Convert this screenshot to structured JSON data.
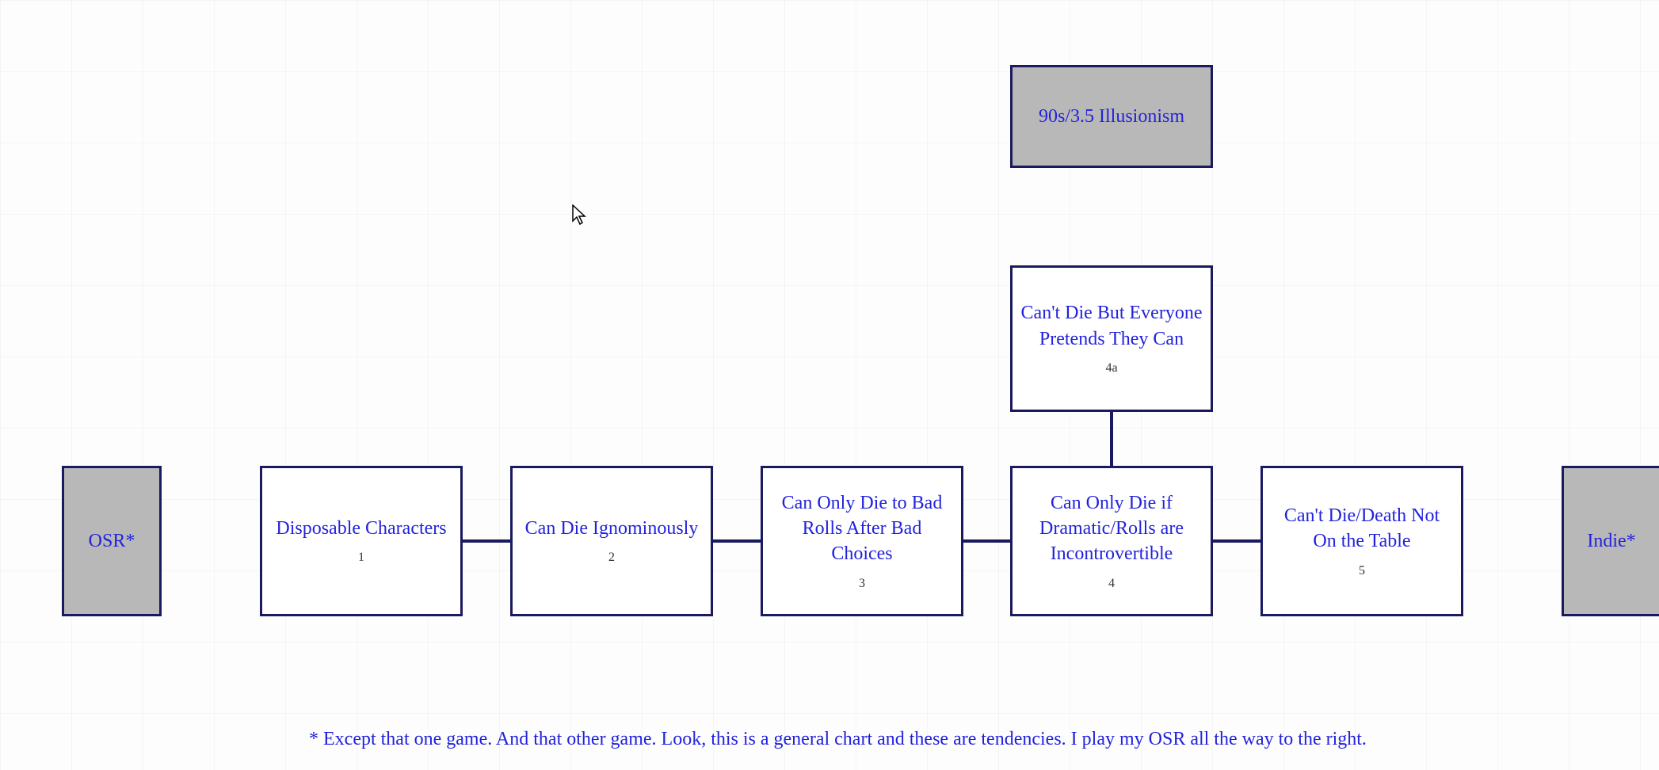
{
  "nodes": {
    "top": {
      "label": "90s/3.5 Illusionism"
    },
    "branch": {
      "label": "Can't Die But Everyone Pretends They Can",
      "sub": "4a"
    },
    "left_cap": {
      "label": "OSR*"
    },
    "right_cap": {
      "label": "Indie*"
    },
    "n1": {
      "label": "Disposable Characters",
      "sub": "1"
    },
    "n2": {
      "label": "Can Die Ignominously",
      "sub": "2"
    },
    "n3": {
      "label": "Can Only Die to Bad Rolls After Bad Choices",
      "sub": "3"
    },
    "n4": {
      "label": "Can Only Die if Dramatic/Rolls are Incontrovertible",
      "sub": "4"
    },
    "n5": {
      "label": "Can't Die/Death Not On the Table",
      "sub": "5"
    }
  },
  "footnote": "* Except that one game. And that other game. Look, this is a general chart and these are tendencies. I play my OSR all the way to the right.",
  "colors": {
    "border": "#1a1a60",
    "text": "#2222dd",
    "shaded": "#b8b8b8"
  }
}
